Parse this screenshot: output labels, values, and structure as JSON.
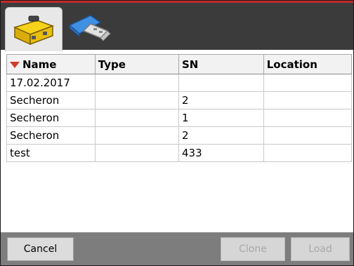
{
  "tabs": [
    {
      "icon": "yellow-toolbox-icon",
      "active": true
    },
    {
      "icon": "usb-drive-icon",
      "active": false
    }
  ],
  "table": {
    "columns": [
      "Name",
      "Type",
      "SN",
      "Location"
    ],
    "sort_column": "Name",
    "sort_indicator_color": "#d23c2c",
    "rows": [
      [
        "17.02.2017",
        "",
        "",
        ""
      ],
      [
        "Secheron",
        "",
        "2",
        ""
      ],
      [
        "Secheron",
        "",
        "1",
        ""
      ],
      [
        "Secheron",
        "",
        "2",
        ""
      ],
      [
        "test",
        "",
        "433",
        ""
      ]
    ]
  },
  "buttons": {
    "cancel": "Cancel",
    "clone": "Clone",
    "load": "Load"
  },
  "colors": {
    "topbar": "#3b3b3b",
    "accent_line": "#c22a2a",
    "bottombar": "#7d7d7d"
  }
}
